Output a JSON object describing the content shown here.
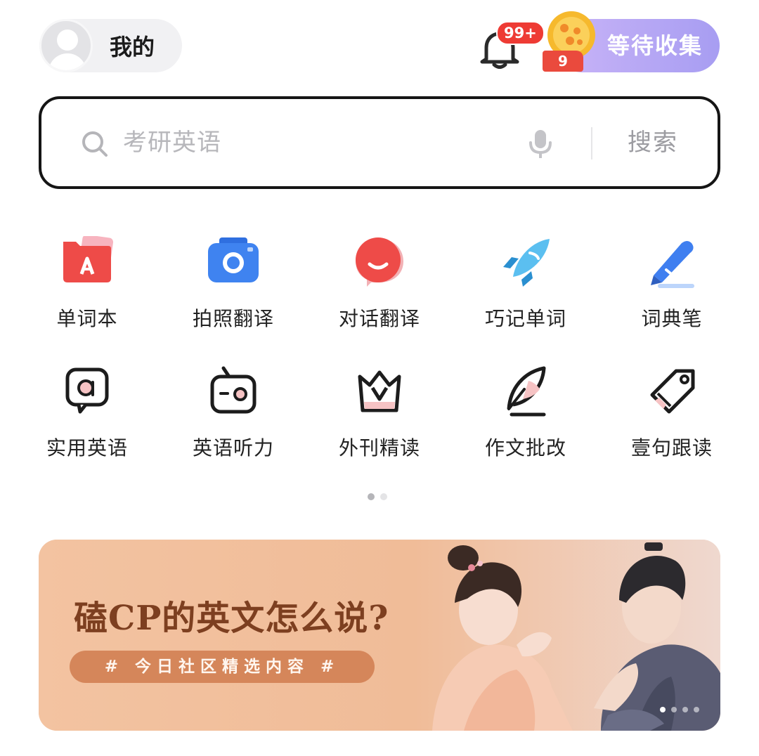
{
  "header": {
    "profile_label": "我的",
    "notification_badge": "99+",
    "collect_label": "等待收集",
    "collect_count": "9"
  },
  "search": {
    "placeholder": "考研英语",
    "button_label": "搜索"
  },
  "tools": [
    {
      "label": "单词本",
      "icon": "wordbook-icon"
    },
    {
      "label": "拍照翻译",
      "icon": "camera-icon"
    },
    {
      "label": "对话翻译",
      "icon": "chat-bubble-icon"
    },
    {
      "label": "巧记单词",
      "icon": "rocket-icon"
    },
    {
      "label": "词典笔",
      "icon": "dictionary-pen-icon"
    },
    {
      "label": "实用英语",
      "icon": "speech-a-icon"
    },
    {
      "label": "英语听力",
      "icon": "radio-icon"
    },
    {
      "label": "外刊精读",
      "icon": "crown-v-icon"
    },
    {
      "label": "作文批改",
      "icon": "quill-icon"
    },
    {
      "label": "壹句跟读",
      "icon": "tag-icon"
    }
  ],
  "pager": {
    "pages": 2,
    "current": 1
  },
  "banner": {
    "title": "磕CP的英文怎么说?",
    "tag": "# 今日社区精选内容 #",
    "slides": 4,
    "current": 1
  },
  "colors": {
    "accent_purple": "#a79df2",
    "badge_red": "#ee3b34",
    "banner_bg": "#f1c2a0",
    "banner_title": "#7d3f20"
  }
}
